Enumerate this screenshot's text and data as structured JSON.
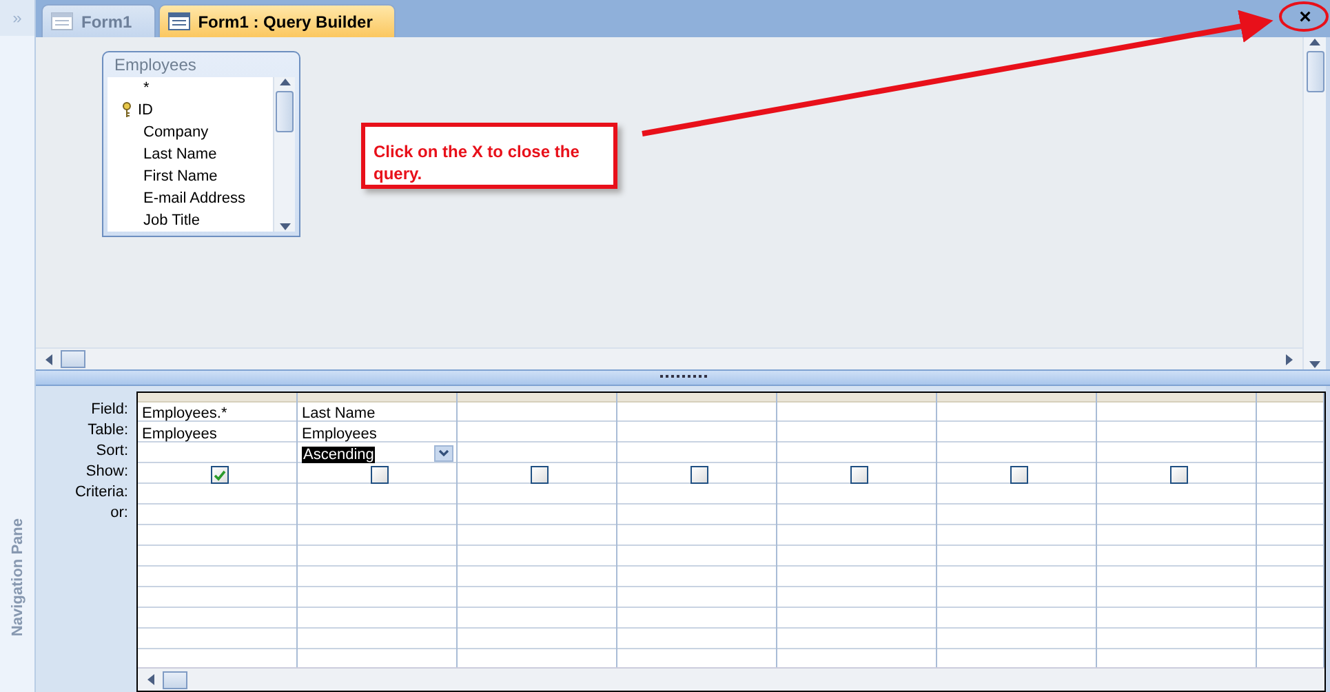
{
  "navigation_pane": {
    "label": "Navigation Pane",
    "toggle": "»"
  },
  "tabs": [
    {
      "label": "Form1",
      "selected": false
    },
    {
      "label": "Form1 : Query Builder",
      "selected": true
    }
  ],
  "close_button": "×",
  "table_list": {
    "title": "Employees",
    "fields": [
      {
        "name": "*",
        "primary_key": false
      },
      {
        "name": "ID",
        "primary_key": true
      },
      {
        "name": "Company",
        "primary_key": false
      },
      {
        "name": "Last Name",
        "primary_key": false
      },
      {
        "name": "First Name",
        "primary_key": false
      },
      {
        "name": "E-mail Address",
        "primary_key": false
      },
      {
        "name": "Job Title",
        "primary_key": false
      }
    ]
  },
  "callout": {
    "text": "Click on the X to close the query."
  },
  "row_labels": [
    "Field:",
    "Table:",
    "Sort:",
    "Show:",
    "Criteria:",
    "or:"
  ],
  "columns": [
    {
      "field": "Employees.*",
      "table": "Employees",
      "show": true
    },
    {
      "field": "Last Name",
      "table": "Employees",
      "sort": "Ascending",
      "sort_selected": true,
      "show": false
    },
    {
      "show": false
    },
    {
      "show": false
    },
    {
      "show": false
    },
    {
      "show": false
    },
    {
      "show": false
    }
  ]
}
